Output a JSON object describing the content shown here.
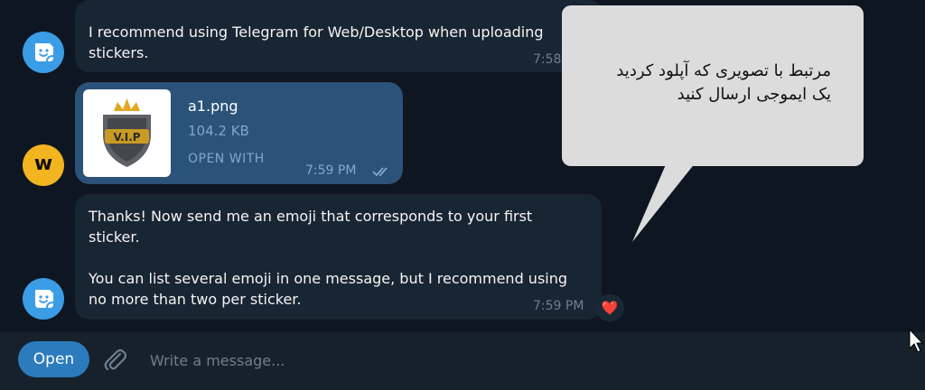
{
  "messages": {
    "bot_message_1": {
      "text": "I recommend using Telegram for Web/Desktop when uploading\nstickers.",
      "time": "7:58"
    },
    "file_message": {
      "file_name": "a1.png",
      "file_size": "104.2 KB",
      "action_label": "OPEN WITH",
      "time": "7:59 PM",
      "thumbnail": {
        "badge_text": "V.I.P",
        "icon": "vip-shield-badge-icon"
      },
      "status_icon": "double-check-icon"
    },
    "bot_message_2": {
      "text": "Thanks! Now send me an emoji that corresponds to your first\nsticker.\n\nYou can list several emoji in one message, but I recommend using\nno more than two per sticker.",
      "time": "7:59 PM",
      "reaction": "❤️"
    }
  },
  "avatars": {
    "bot_icon": "sticker-bot-icon",
    "user_letter": "w"
  },
  "callout": {
    "line1": "مرتبط با تصویری که آپلود کردید",
    "line2": "یک ایموجی ارسال کنید"
  },
  "composer": {
    "open_label": "Open",
    "placeholder": "Write a message...",
    "attach_icon": "paperclip-icon"
  },
  "colors": {
    "background": "#0e1621",
    "incoming_bubble": "#182533",
    "outgoing_bubble": "#2b5278",
    "accent": "#2b7bbd",
    "callout": "#dcdcdc"
  }
}
